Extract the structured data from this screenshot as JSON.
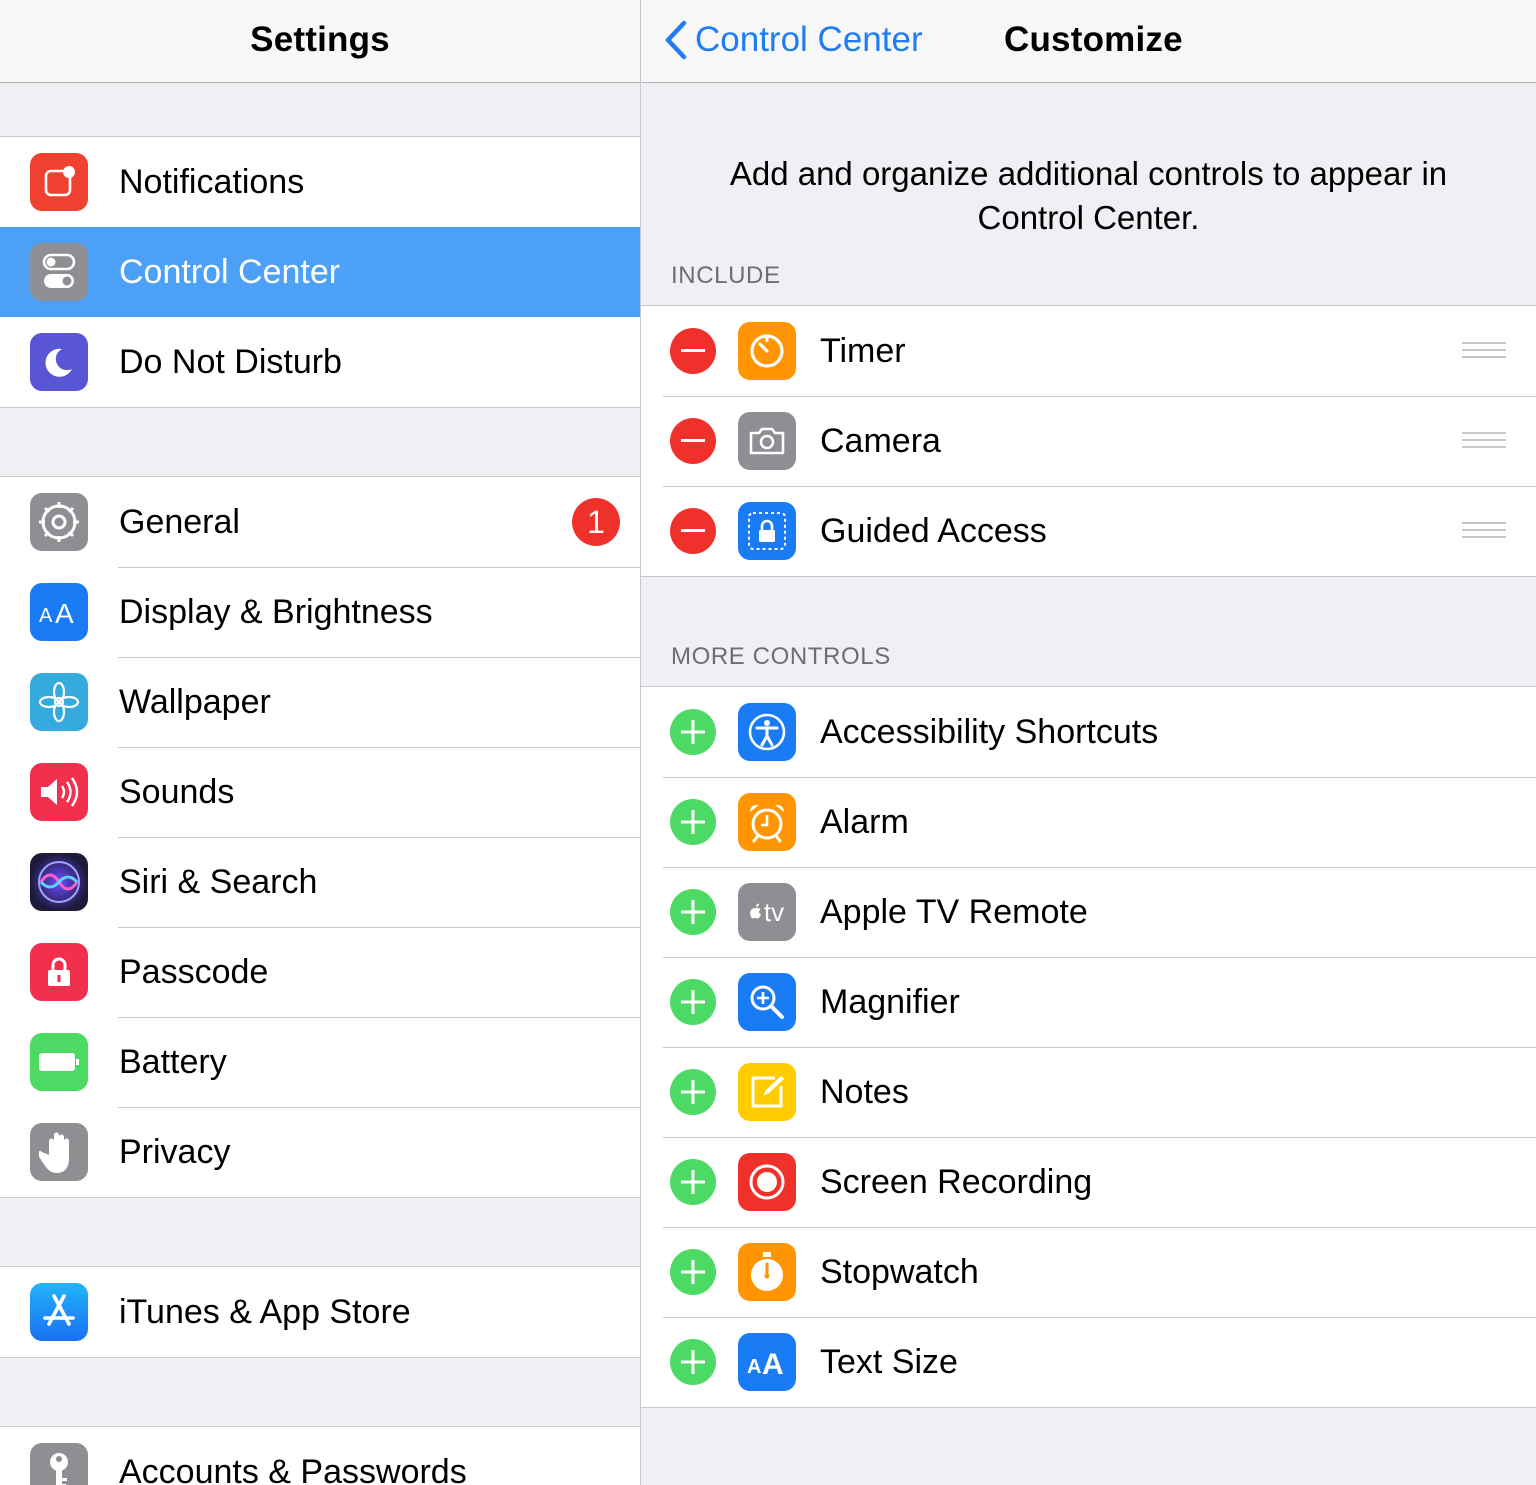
{
  "sidebar": {
    "title": "Settings",
    "group1": [
      {
        "label": "Notifications",
        "icon": "notifications-icon",
        "color": "#f0402f"
      },
      {
        "label": "Control Center",
        "icon": "control-center-icon",
        "color": "#8e8e93",
        "selected": true
      },
      {
        "label": "Do Not Disturb",
        "icon": "moon-icon",
        "color": "#5856d6"
      }
    ],
    "group2": [
      {
        "label": "General",
        "icon": "gear-icon",
        "color": "#8e8e93",
        "badge": "1"
      },
      {
        "label": "Display & Brightness",
        "icon": "display-icon",
        "color": "#1a7cf5"
      },
      {
        "label": "Wallpaper",
        "icon": "wallpaper-icon",
        "color": "#35aadc"
      },
      {
        "label": "Sounds",
        "icon": "speaker-icon",
        "color": "#f1304d"
      },
      {
        "label": "Siri & Search",
        "icon": "siri-icon",
        "color": "#1a1a2e"
      },
      {
        "label": "Passcode",
        "icon": "lock-icon",
        "color": "#f1304d"
      },
      {
        "label": "Battery",
        "icon": "battery-icon",
        "color": "#4cd964"
      },
      {
        "label": "Privacy",
        "icon": "hand-icon",
        "color": "#8e8e93"
      }
    ],
    "group3": [
      {
        "label": "iTunes & App Store",
        "icon": "app-store-icon",
        "color": "#1d8ef6"
      }
    ],
    "group4": [
      {
        "label": "Accounts & Passwords",
        "icon": "key-icon",
        "color": "#8e8e93"
      }
    ]
  },
  "detail": {
    "back_label": "Control Center",
    "title": "Customize",
    "description": "Add and organize additional controls to appear in Control Center.",
    "include_header": "INCLUDE",
    "include": [
      {
        "label": "Timer",
        "icon": "timer-icon",
        "color": "#ff9500"
      },
      {
        "label": "Camera",
        "icon": "camera-icon",
        "color": "#8e8e93"
      },
      {
        "label": "Guided Access",
        "icon": "guided-access-icon",
        "color": "#1a7cf5"
      }
    ],
    "more_header": "MORE CONTROLS",
    "more": [
      {
        "label": "Accessibility Shortcuts",
        "icon": "accessibility-icon",
        "color": "#1a7cf5"
      },
      {
        "label": "Alarm",
        "icon": "alarm-icon",
        "color": "#ff9500"
      },
      {
        "label": "Apple TV Remote",
        "icon": "apple-tv-icon",
        "color": "#8e8e93",
        "text": "tv"
      },
      {
        "label": "Magnifier",
        "icon": "magnifier-icon",
        "color": "#1a7cf5"
      },
      {
        "label": "Notes",
        "icon": "notes-icon",
        "color": "#ffcc00"
      },
      {
        "label": "Screen Recording",
        "icon": "screen-recording-icon",
        "color": "#f0312b"
      },
      {
        "label": "Stopwatch",
        "icon": "stopwatch-icon",
        "color": "#ff9500"
      },
      {
        "label": "Text Size",
        "icon": "text-size-icon",
        "color": "#1a7cf5",
        "text": "AA"
      }
    ]
  }
}
